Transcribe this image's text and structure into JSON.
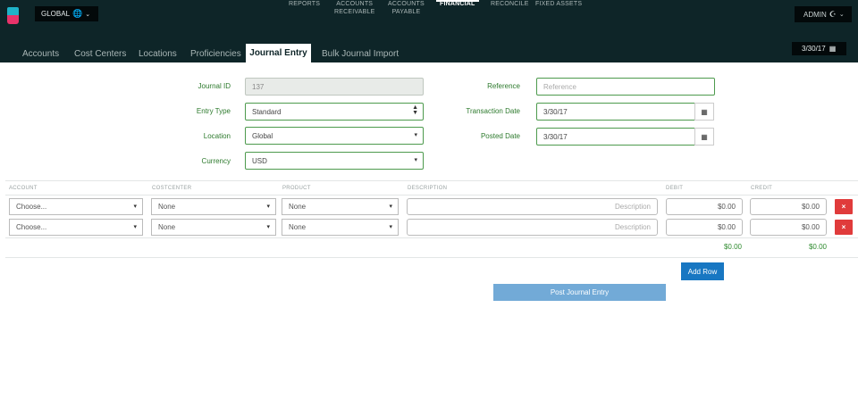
{
  "header": {
    "global_label": "GLOBAL",
    "admin_label": "ADMIN",
    "date_label": "3/30/17",
    "nav": [
      {
        "line1": "REPORTS",
        "line2": ""
      },
      {
        "line1": "ACCOUNTS",
        "line2": "RECEIVABLE"
      },
      {
        "line1": "ACCOUNTS",
        "line2": "PAYABLE"
      },
      {
        "line1": "FINANCIAL",
        "line2": ""
      },
      {
        "line1": "RECONCILE",
        "line2": ""
      },
      {
        "line1": "FIXED ASSETS",
        "line2": ""
      }
    ],
    "subnav": [
      "Accounts",
      "Cost Centers",
      "Locations",
      "Proficiencies",
      "Journal Entry",
      "Bulk Journal Import"
    ]
  },
  "form": {
    "journal_id_label": "Journal ID",
    "journal_id_value": "137",
    "entry_type_label": "Entry Type",
    "entry_type_value": "Standard",
    "location_label": "Location",
    "location_value": "Global",
    "currency_label": "Currency",
    "currency_value": "USD",
    "reference_label": "Reference",
    "reference_placeholder": "Reference",
    "transaction_date_label": "Transaction Date",
    "transaction_date_value": "3/30/17",
    "posted_date_label": "Posted Date",
    "posted_date_value": "3/30/17"
  },
  "table": {
    "headers": [
      "ACCOUNT",
      "COSTCENTER",
      "PRODUCT",
      "DESCRIPTION",
      "DEBIT",
      "CREDIT"
    ],
    "rows": [
      {
        "account": "Choose...",
        "costcenter": "None",
        "product": "None",
        "description_placeholder": "Description",
        "debit": "$0.00",
        "credit": "$0.00",
        "delete": "×"
      },
      {
        "account": "Choose...",
        "costcenter": "None",
        "product": "None",
        "description_placeholder": "Description",
        "debit": "$0.00",
        "credit": "$0.00",
        "delete": "×"
      }
    ],
    "total_debit": "$0.00",
    "total_credit": "$0.00"
  },
  "actions": {
    "add_row": "Add Row",
    "post": "Post Journal Entry"
  },
  "colors": {
    "header_bg": "#0e2528",
    "accent_green": "#2d7a2d",
    "primary_blue": "#1877c2",
    "danger_red": "#e03b3b"
  },
  "icons": [
    "globe-icon",
    "chevron-down-icon",
    "headphones-icon",
    "calendar-icon",
    "caret-down-icon",
    "updown-icon",
    "close-icon"
  ]
}
